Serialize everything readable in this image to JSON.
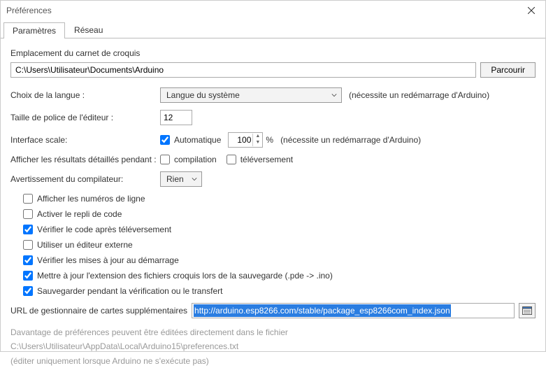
{
  "window": {
    "title": "Préférences"
  },
  "tabs": {
    "settings": "Paramètres",
    "network": "Réseau"
  },
  "sketchbook": {
    "label": "Emplacement du carnet de croquis",
    "path": "C:\\Users\\Utilisateur\\Documents\\Arduino",
    "browse": "Parcourir"
  },
  "language": {
    "label": "Choix de la langue :",
    "value": "Langue du système",
    "hint": "(nécessite un redémarrage d'Arduino)"
  },
  "fontsize": {
    "label": "Taille de police de l'éditeur :",
    "value": "12"
  },
  "scale": {
    "label": "Interface scale:",
    "auto_label": "Automatique",
    "value": "100",
    "pct": "%",
    "hint": "(nécessite un redémarrage d'Arduino)"
  },
  "verbose": {
    "label": "Afficher les résultats détaillés pendant :",
    "compile": "compilation",
    "upload": "téléversement"
  },
  "warnings": {
    "label": "Avertissement du compilateur:",
    "value": "Rien"
  },
  "checks": {
    "linenumbers": "Afficher les numéros de ligne",
    "codefold": "Activer le repli de code",
    "verify_upload": "Vérifier le code après téléversement",
    "external_editor": "Utiliser un éditeur externe",
    "check_updates": "Vérifier les mises à jour au démarrage",
    "update_ext": "Mettre à jour  l'extension des fichiers croquis lors de la sauvegarde (.pde -> .ino)",
    "save_verify": "Sauvegarder pendant la vérification ou le transfert"
  },
  "boards_url": {
    "label": "URL de gestionnaire de cartes supplémentaires",
    "value": "http://arduino.esp8266.com/stable/package_esp8266com_index.json"
  },
  "footnote": {
    "l1": "Davantage de préférences peuvent être éditées directement dans le fichier",
    "l2": "C:\\Users\\Utilisateur\\AppData\\Local\\Arduino15\\preferences.txt",
    "l3": "(éditer uniquement lorsque Arduino ne s'exécute pas)"
  }
}
